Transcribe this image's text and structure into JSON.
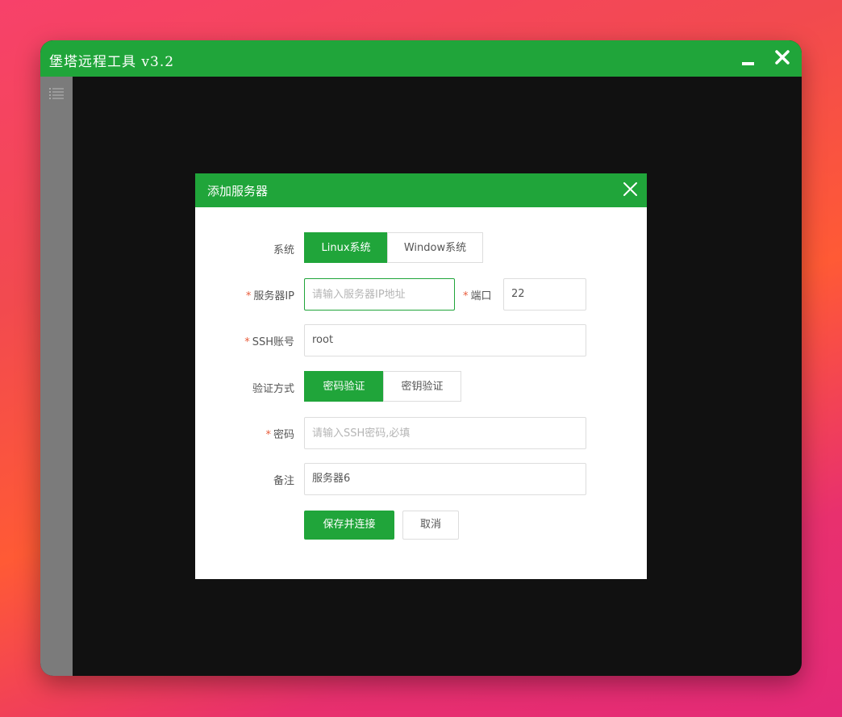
{
  "window": {
    "title": "堡塔远程工具 v3.2"
  },
  "dialog": {
    "title": "添加服务器",
    "system": {
      "label": "系统",
      "options": [
        "Linux系统",
        "Window系统"
      ],
      "selected": "Linux系统"
    },
    "server_ip": {
      "required": "*",
      "label": "服务器IP",
      "value": "",
      "placeholder": "请输入服务器IP地址"
    },
    "port": {
      "required": "*",
      "label": "端口",
      "value": "22"
    },
    "ssh_account": {
      "required": "*",
      "label": "SSH账号",
      "value": "root"
    },
    "auth_method": {
      "label": "验证方式",
      "options": [
        "密码验证",
        "密钥验证"
      ],
      "selected": "密码验证"
    },
    "password": {
      "required": "*",
      "label": "密码",
      "value": "",
      "placeholder": "请输入SSH密码,必填"
    },
    "remark": {
      "label": "备注",
      "value": "服务器6"
    },
    "buttons": {
      "save": "保存并连接",
      "cancel": "取消"
    }
  },
  "colors": {
    "accent": "#20a53a",
    "required": "#e85c3b",
    "sidebar": "#7b7b7b",
    "workspace": "#111111"
  },
  "icons": {
    "menu": "list-menu-icon",
    "minimize": "minimize-icon",
    "close": "close-icon"
  }
}
